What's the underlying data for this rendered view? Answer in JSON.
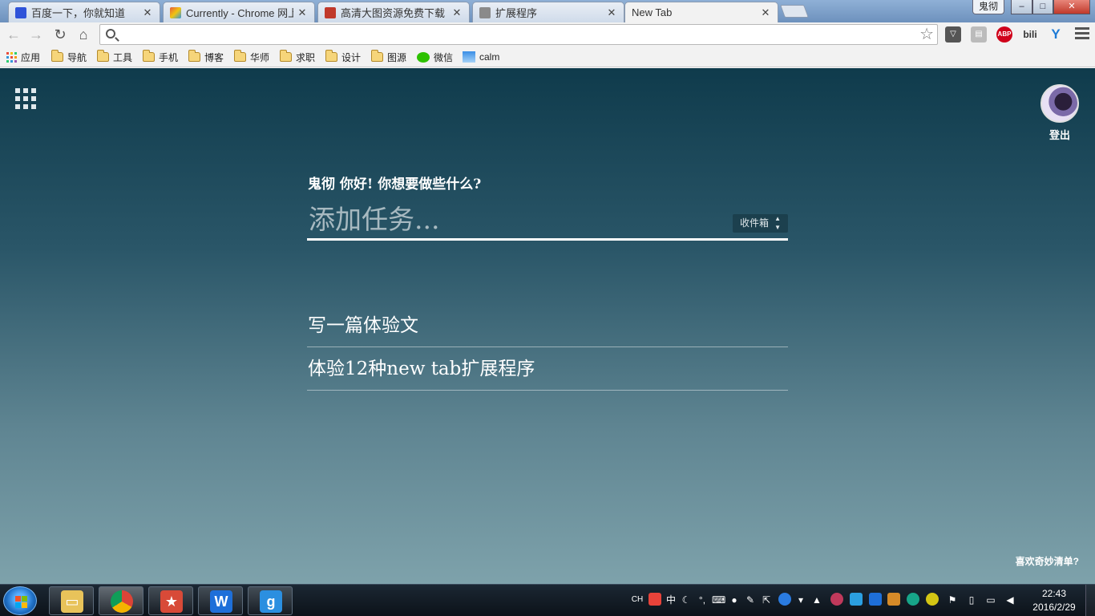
{
  "browser": {
    "tabs": [
      {
        "title": "百度一下，你就知道",
        "favicon_color": "#2f53d9"
      },
      {
        "title": "Currently - Chrome 网上",
        "favicon_color": "#e55b3c"
      },
      {
        "title": "高清大图资源免费下载 | B",
        "favicon_color": "#c0392b"
      },
      {
        "title": "扩展程序",
        "favicon_color": "#8a8a8a"
      },
      {
        "title": "New Tab",
        "favicon_color": "none"
      }
    ],
    "user": "鬼彻",
    "window_controls": {
      "minimize": "–",
      "maximize": "□",
      "close": "✕"
    },
    "address": {
      "value": "",
      "placeholder": ""
    },
    "extensions": [
      "pocket-icon",
      "reader-icon",
      "adblock-icon",
      "bilibili-icon",
      "vpn-icon"
    ],
    "adblock_label": "ABP",
    "bilibili_label": "bili",
    "bookmarks": [
      {
        "label": "应用",
        "icon": "apps-grid-icon"
      },
      {
        "label": "导航",
        "icon": "folder-icon"
      },
      {
        "label": "工具",
        "icon": "folder-icon"
      },
      {
        "label": "手机",
        "icon": "folder-icon"
      },
      {
        "label": "博客",
        "icon": "folder-icon"
      },
      {
        "label": "华师",
        "icon": "folder-icon"
      },
      {
        "label": "求职",
        "icon": "folder-icon"
      },
      {
        "label": "设计",
        "icon": "folder-icon"
      },
      {
        "label": "图源",
        "icon": "folder-icon"
      },
      {
        "label": "微信",
        "icon": "wechat-icon"
      },
      {
        "label": "calm",
        "icon": "calm-icon"
      }
    ]
  },
  "newtab": {
    "logout": "登出",
    "greeting": "鬼彻 你好! 你想要做些什么?",
    "task_placeholder": "添加任务...",
    "list_select": "收件箱",
    "tasks": [
      "写一篇体验文",
      "体验12种new tab扩展程序"
    ],
    "footer_link": "喜欢奇妙清单?"
  },
  "taskbar": {
    "apps": [
      "file-explorer-icon",
      "chrome-icon",
      "wunderlist-icon",
      "wps-writer-icon",
      "app-store-icon"
    ],
    "tray": {
      "lang": "CH",
      "ime": "中",
      "punct": "°,"
    },
    "clock": {
      "time": "22:43",
      "date": "2016/2/29"
    }
  },
  "colors": {
    "page_top": "#0f3b4c",
    "page_bottom": "#7ea2ab",
    "accent": "#ffffff"
  }
}
